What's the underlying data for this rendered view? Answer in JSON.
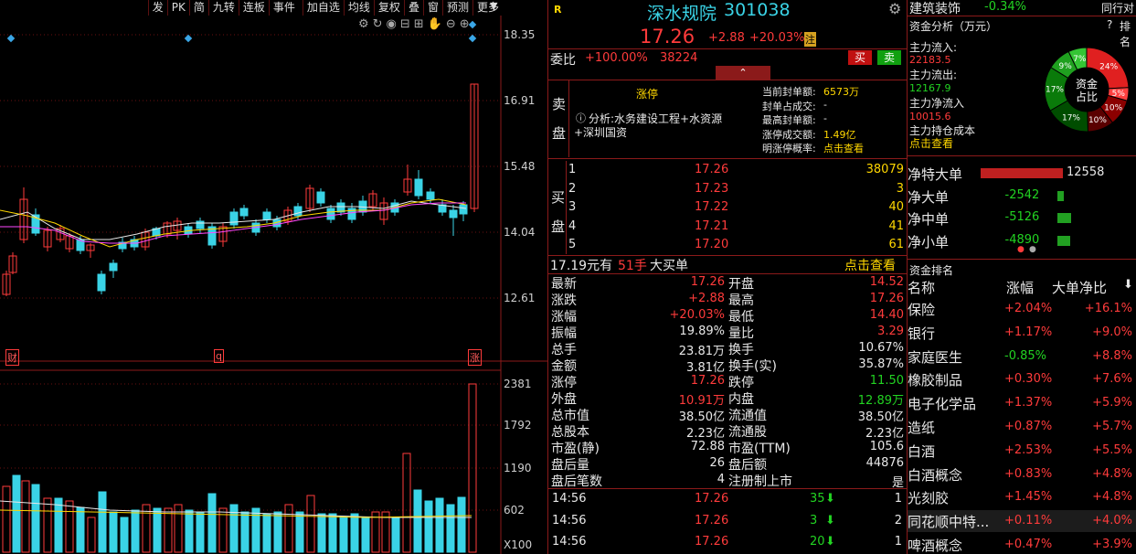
{
  "toolbar": [
    "发",
    "PK",
    "简",
    "九转",
    "连板",
    "事件",
    "加自选",
    "均线",
    "复权",
    "叠",
    "窗",
    "预测",
    "更多"
  ],
  "chart": {
    "price_ticks": [
      "18.35",
      "16.91",
      "15.48",
      "14.04",
      "12.61"
    ],
    "vol_ticks": [
      "2381",
      "1792",
      "1190",
      "602",
      "X100"
    ],
    "markers": [
      "财",
      "q",
      "涨"
    ]
  },
  "stock": {
    "name": "深水规院",
    "code": "301038",
    "tag": "R",
    "price": "17.26",
    "change": "+2.88",
    "pct": "+20.03%",
    "badge": "注"
  },
  "weibi": {
    "label": "委比",
    "pct": "+100.00%",
    "vol": "38224",
    "buy_label": "买",
    "sell_label": "卖"
  },
  "limit": {
    "side_label": "卖盘",
    "status": "涨停",
    "analysis": "分析:水务建设工程+水资源",
    "analysis2": "+深圳国资",
    "info": [
      [
        "当前封单额:",
        "6573万"
      ],
      [
        "封单占成交:",
        "-"
      ],
      [
        "最高封单额:",
        "-"
      ],
      [
        "涨停成交额:",
        "1.49亿"
      ],
      [
        "明涨停概率:",
        "点击查看"
      ]
    ]
  },
  "bids": {
    "side_label": "买盘",
    "rows": [
      [
        "1",
        "17.26",
        "38079"
      ],
      [
        "2",
        "17.23",
        "3"
      ],
      [
        "3",
        "17.22",
        "40"
      ],
      [
        "4",
        "17.21",
        "41"
      ],
      [
        "5",
        "17.20",
        "61"
      ]
    ]
  },
  "bigorder": {
    "price": "17.19元有",
    "vol": "51手",
    "text": "大买单",
    "link": "点击查看"
  },
  "stats": [
    [
      "最新",
      "17.26",
      "开盘",
      "14.52"
    ],
    [
      "涨跌",
      "+2.88",
      "最高",
      "17.26"
    ],
    [
      "涨幅",
      "+20.03%",
      "最低",
      "14.40"
    ],
    [
      "振幅",
      "19.89%",
      "量比",
      "3.29"
    ],
    [
      "总手",
      "23.81万",
      "换手",
      "10.67%"
    ],
    [
      "金额",
      "3.81亿",
      "换手(实)",
      "35.87%"
    ],
    [
      "涨停",
      "17.26",
      "跌停",
      "11.50"
    ],
    [
      "外盘",
      "10.91万",
      "内盘",
      "12.89万"
    ],
    [
      "总市值",
      "38.50亿",
      "流通值",
      "38.50亿"
    ],
    [
      "总股本",
      "2.23亿",
      "流通股",
      "2.23亿"
    ],
    [
      "市盈(静)",
      "72.88",
      "市盈(TTM)",
      "105.6"
    ],
    [
      "盘后量",
      "26",
      "盘后额",
      "44876"
    ],
    [
      "盘后笔数",
      "4",
      "注册制上市",
      "是"
    ]
  ],
  "ticks": [
    [
      "14:56",
      "17.26",
      "35",
      "1"
    ],
    [
      "14:56",
      "17.26",
      "3",
      "2"
    ],
    [
      "14:56",
      "17.26",
      "20",
      "1"
    ]
  ],
  "sector": {
    "name": "建筑装饰",
    "pct": "-0.34%",
    "tab": "同行对"
  },
  "fund": {
    "title": "资金分析（万元）",
    "rank": "排名",
    "inflow_label": "主力流入:",
    "inflow": "22183.5",
    "outflow_label": "主力流出:",
    "outflow": "12167.9",
    "net_label": "主力净流入",
    "net": "10015.6",
    "cost_label": "主力持仓成本",
    "cost_link": "点击查看",
    "pie_center1": "资金",
    "pie_center2": "占比",
    "pie": [
      {
        "v": 24,
        "c": "#e02020",
        "l": "24%"
      },
      {
        "v": 5,
        "c": "#ff4040",
        "l": "5%"
      },
      {
        "v": 10,
        "c": "#8b0000",
        "l": "10%"
      },
      {
        "v": 10,
        "c": "#5a0000",
        "l": "10%"
      },
      {
        "v": 17,
        "c": "#004d00",
        "l": "17%"
      },
      {
        "v": 17,
        "c": "#0a7a0a",
        "l": "17%"
      },
      {
        "v": 9,
        "c": "#1fa01f",
        "l": "9%"
      },
      {
        "v": 7,
        "c": "#34c534",
        "l": "7%"
      }
    ]
  },
  "net": [
    [
      "净特大单",
      "12558",
      12558
    ],
    [
      "净大单",
      "-2542",
      -2542
    ],
    [
      "净中单",
      "-5126",
      -5126
    ],
    [
      "净小单",
      "-4890",
      -4890
    ]
  ],
  "ranking": {
    "title": "资金排名",
    "headers": [
      "名称",
      "涨幅",
      "大单净比"
    ],
    "rows": [
      [
        "保险",
        "+2.04%",
        "+16.1%"
      ],
      [
        "银行",
        "+1.17%",
        "+9.0%"
      ],
      [
        "家庭医生",
        "-0.85%",
        "+8.8%"
      ],
      [
        "橡胶制品",
        "+0.30%",
        "+7.6%"
      ],
      [
        "电子化学品",
        "+1.37%",
        "+5.9%"
      ],
      [
        "造纸",
        "+0.87%",
        "+5.7%"
      ],
      [
        "白酒",
        "+2.53%",
        "+5.5%"
      ],
      [
        "白酒概念",
        "+0.83%",
        "+4.8%"
      ],
      [
        "光刻胶",
        "+1.45%",
        "+4.8%"
      ],
      [
        "同花顺中特...",
        "+0.11%",
        "+4.0%"
      ],
      [
        "啤酒概念",
        "+0.47%",
        "+3.9%"
      ]
    ]
  },
  "colors": {
    "up": "#ff3b3b",
    "down": "#22d322",
    "cyan": "#3ad3e6",
    "frame": "#8b1a1a"
  }
}
